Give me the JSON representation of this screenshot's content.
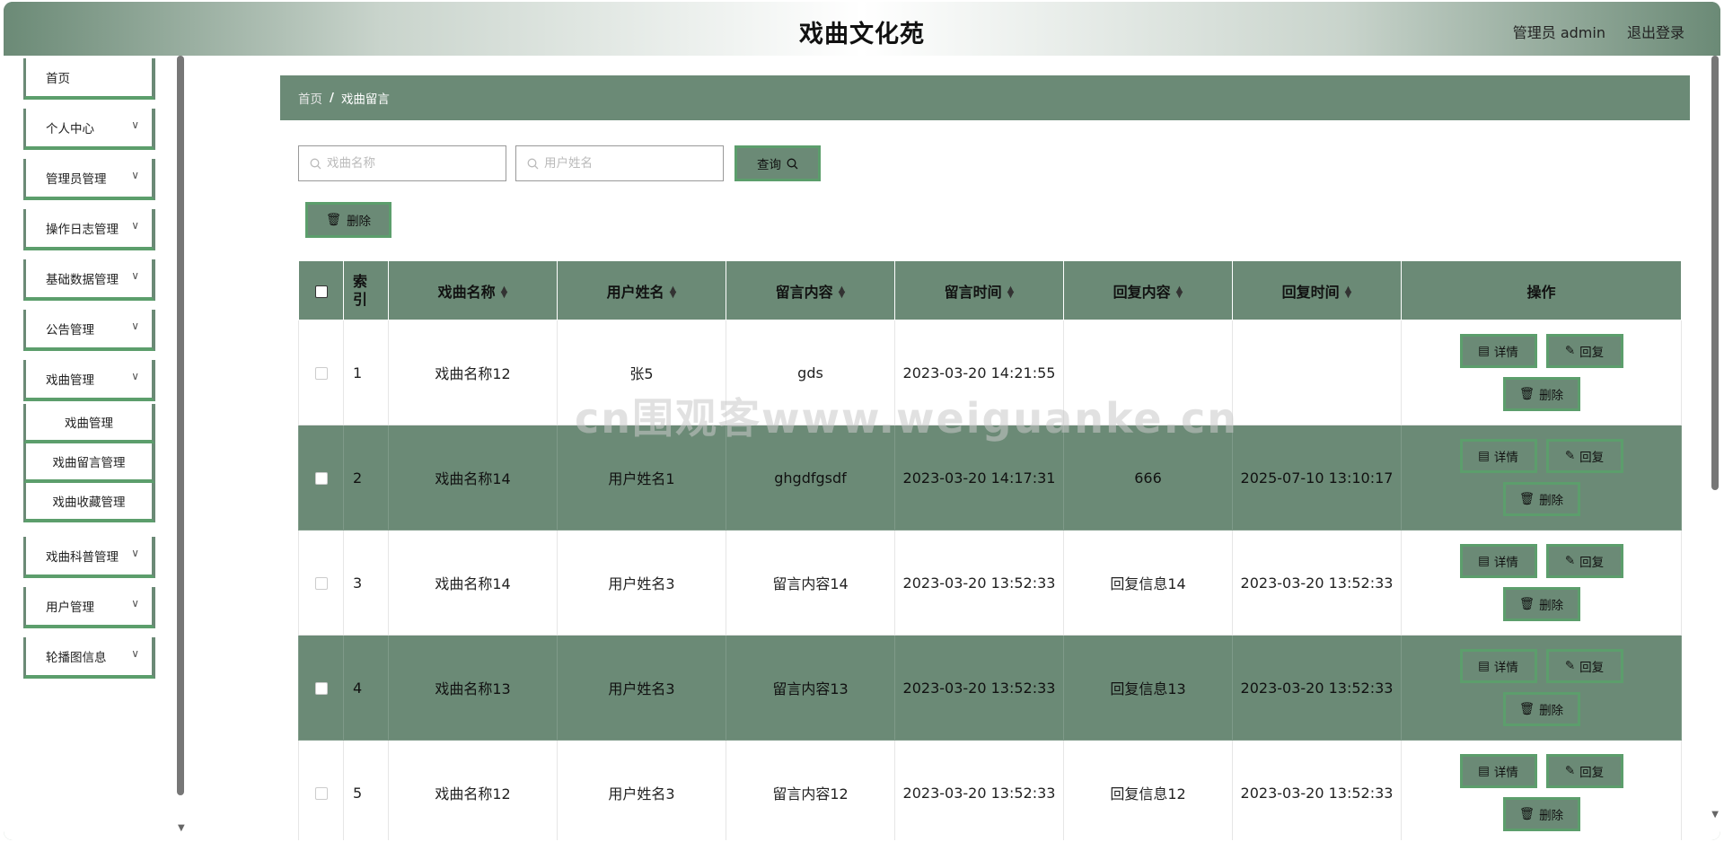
{
  "header": {
    "title": "戏曲文化苑",
    "user": "管理员 admin",
    "logout": "退出登录"
  },
  "sidebar": {
    "items": [
      {
        "label": "首页",
        "has_children": false
      },
      {
        "label": "个人中心",
        "has_children": true
      },
      {
        "label": "管理员管理",
        "has_children": true
      },
      {
        "label": "操作日志管理",
        "has_children": true
      },
      {
        "label": "基础数据管理",
        "has_children": true
      },
      {
        "label": "公告管理",
        "has_children": true
      },
      {
        "label": "戏曲管理",
        "has_children": true
      },
      {
        "label": "戏曲科普管理",
        "has_children": true
      },
      {
        "label": "用户管理",
        "has_children": true
      },
      {
        "label": "轮播图信息",
        "has_children": true
      }
    ],
    "submenu": [
      "戏曲管理",
      "戏曲留言管理",
      "戏曲收藏管理"
    ],
    "chevron": "chevron-down-icon"
  },
  "breadcrumb": {
    "home": "首页",
    "separator": "/",
    "current": "戏曲留言"
  },
  "search": {
    "opera_placeholder": "戏曲名称",
    "user_placeholder": "用户姓名",
    "query_label": "查询",
    "delete_label": "删除"
  },
  "table": {
    "headers": [
      "索引",
      "戏曲名称",
      "用户姓名",
      "留言内容",
      "留言时间",
      "回复内容",
      "回复时间",
      "操作"
    ],
    "header_index_top": "索",
    "header_index_bottom": "引",
    "rows": [
      {
        "index": "1",
        "opera": "戏曲名称12",
        "user": "张5",
        "content": "gds",
        "time": "2023-03-20 14:21:55",
        "reply": "",
        "reply_time": ""
      },
      {
        "index": "2",
        "opera": "戏曲名称14",
        "user": "用户姓名1",
        "content": "ghgdfgsdf",
        "time": "2023-03-20 14:17:31",
        "reply": "666",
        "reply_time": "2025-07-10 13:10:17"
      },
      {
        "index": "3",
        "opera": "戏曲名称14",
        "user": "用户姓名3",
        "content": "留言内容14",
        "time": "2023-03-20 13:52:33",
        "reply": "回复信息14",
        "reply_time": "2023-03-20 13:52:33"
      },
      {
        "index": "4",
        "opera": "戏曲名称13",
        "user": "用户姓名3",
        "content": "留言内容13",
        "time": "2023-03-20 13:52:33",
        "reply": "回复信息13",
        "reply_time": "2023-03-20 13:52:33"
      },
      {
        "index": "5",
        "opera": "戏曲名称12",
        "user": "用户姓名3",
        "content": "留言内容12",
        "time": "2023-03-20 13:52:33",
        "reply": "回复信息12",
        "reply_time": "2023-03-20 13:52:33"
      }
    ],
    "actions": {
      "detail": "详情",
      "reply": "回复",
      "delete": "删除"
    }
  },
  "watermark": "cn围观客www.weiguanke.cn",
  "colors": {
    "accent": "#6b8a76",
    "accent_border": "#5c9e6c"
  }
}
